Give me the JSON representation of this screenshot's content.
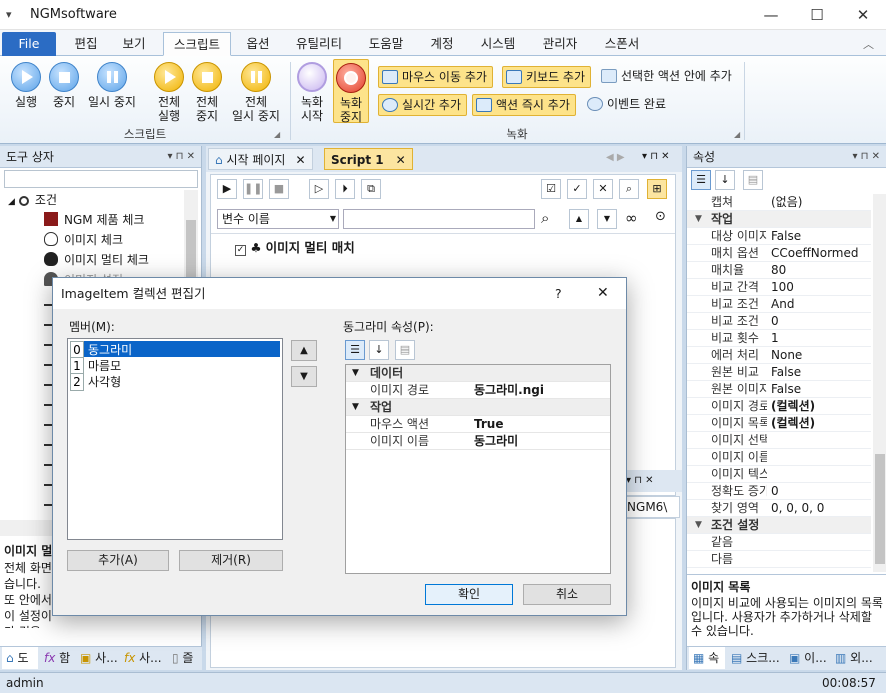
{
  "window": {
    "title": "NGMsoftware",
    "sysmenu_glyph": "▾",
    "minimize": "—",
    "maximize": "☐",
    "close": "✕"
  },
  "ribbon_tabs": [
    "File",
    "편집",
    "보기",
    "스크립트",
    "옵션",
    "유틸리티",
    "도움말",
    "계정",
    "시스템",
    "관리자",
    "스폰서"
  ],
  "ribbon_collapse": "︿",
  "ribbon": {
    "script_group": {
      "label": "스크립트",
      "buttons": [
        {
          "label1": "실행",
          "label2": "",
          "icon": "play-icon"
        },
        {
          "label1": "중지",
          "label2": "",
          "icon": "stop-icon"
        },
        {
          "label1": "일시 중지",
          "label2": "",
          "icon": "pause-icon"
        },
        {
          "label1": "전체",
          "label2": "실행",
          "icon": "play-all-icon"
        },
        {
          "label1": "전체",
          "label2": "중지",
          "icon": "stop-all-icon"
        },
        {
          "label1": "전체",
          "label2": "일시 중지",
          "icon": "pause-all-icon"
        }
      ]
    },
    "record_group": {
      "label": "녹화",
      "start": {
        "label1": "녹화",
        "label2": "시작"
      },
      "stop": {
        "label1": "녹화",
        "label2": "중지"
      },
      "small_buttons": [
        "마우스 이동 추가",
        "키보드 추가",
        "선택한 액션 안에 추가",
        "실시간 추가",
        "액션 즉시 추가",
        "이벤트 완료"
      ]
    }
  },
  "toolbox": {
    "title": "도구 상자",
    "pin": "▾  ⊓  ✕",
    "tree": [
      {
        "label": "조건",
        "level": 0,
        "icon": "branch-icon"
      },
      {
        "label": "NGM 제품 체크",
        "level": 1,
        "icon": "ngm-icon"
      },
      {
        "label": "이미지 체크",
        "level": 1,
        "icon": "cloud-icon"
      },
      {
        "label": "이미지 멀티 체크",
        "level": 1,
        "icon": "cloud-filled-icon"
      },
      {
        "label": "이미지 설정",
        "level": 1,
        "icon": "fire-icon"
      }
    ],
    "desc_title": "이미지 멀",
    "desc_text": "전체 화면 습니다. 또 안에서 이 설정이 가 건을 설정할 수 있습니다.",
    "bottom_tabs": [
      "도",
      "함",
      "사...",
      "사...",
      "즐"
    ]
  },
  "documents": {
    "tabs": [
      "시작 페이지",
      "Script 1"
    ],
    "filter_label": "변수 이름",
    "action_title": "이미지 멀티 매치",
    "lower_text": "\\NGM6\\"
  },
  "properties": {
    "title": "속성",
    "rows": [
      {
        "type": "row",
        "k": "캡쳐",
        "v": "(없음)"
      },
      {
        "type": "cat",
        "k": "작업"
      },
      {
        "type": "row",
        "k": "대상 이미지",
        "v": "False"
      },
      {
        "type": "row",
        "k": "매치 옵션",
        "v": "CCoeffNormed"
      },
      {
        "type": "row",
        "k": "매치율",
        "v": "80"
      },
      {
        "type": "row",
        "k": "비교 간격",
        "v": "100"
      },
      {
        "type": "row",
        "k": "비교 조건",
        "v": "And"
      },
      {
        "type": "row",
        "k": "비교 조건",
        "v": "0"
      },
      {
        "type": "row",
        "k": "비교 횟수",
        "v": "1"
      },
      {
        "type": "row",
        "k": "에러 처리",
        "v": "None"
      },
      {
        "type": "row",
        "k": "원본 비교",
        "v": "False"
      },
      {
        "type": "row",
        "k": "원본 이미지",
        "v": "False"
      },
      {
        "type": "row",
        "k": "이미지 경로",
        "v": "(컬렉션)"
      },
      {
        "type": "row",
        "k": "이미지 목록",
        "v": "(컬렉션)"
      },
      {
        "type": "row",
        "k": "이미지 선택",
        "v": ""
      },
      {
        "type": "row",
        "k": "이미지 이름",
        "v": ""
      },
      {
        "type": "row",
        "k": "이미지 텍스트",
        "v": ""
      },
      {
        "type": "row",
        "k": "정확도 증가",
        "v": "0"
      },
      {
        "type": "row",
        "k": "찾기 영역",
        "v": "0, 0, 0, 0"
      },
      {
        "type": "cat",
        "k": "조건 설정"
      },
      {
        "type": "row",
        "k": "같음",
        "v": ""
      },
      {
        "type": "row",
        "k": "다름",
        "v": ""
      }
    ],
    "desc_title": "이미지 목록",
    "desc_text": "이미지 비교에 사용되는 이미지의 목록입니다. 사용자가 추가하거나 삭제할 수 있습니다.",
    "bottom_tabs": [
      "속",
      "스크...",
      "이...",
      "외..."
    ]
  },
  "dialog": {
    "title": "ImageItem 컬렉션 편집기",
    "help": "?",
    "close": "✕",
    "members_label": "멤버(M):",
    "members": [
      {
        "idx": "0",
        "name": "동그라미"
      },
      {
        "idx": "1",
        "name": "마름모"
      },
      {
        "idx": "2",
        "name": "사각형"
      }
    ],
    "props_label": "동그라미 속성(P):",
    "props": [
      {
        "type": "cat",
        "k": "데이터"
      },
      {
        "type": "row",
        "k": "이미지 경로",
        "v": "동그라미.ngi"
      },
      {
        "type": "cat",
        "k": "작업"
      },
      {
        "type": "row",
        "k": "마우스 액션",
        "v": "True"
      },
      {
        "type": "row",
        "k": "이미지 이름",
        "v": "동그라미"
      }
    ],
    "add": "추가(A)",
    "remove": "제거(R)",
    "ok": "확인",
    "cancel": "취소",
    "up": "▲",
    "down": "▼"
  },
  "status": {
    "user": "admin",
    "time": "00:08:57"
  }
}
